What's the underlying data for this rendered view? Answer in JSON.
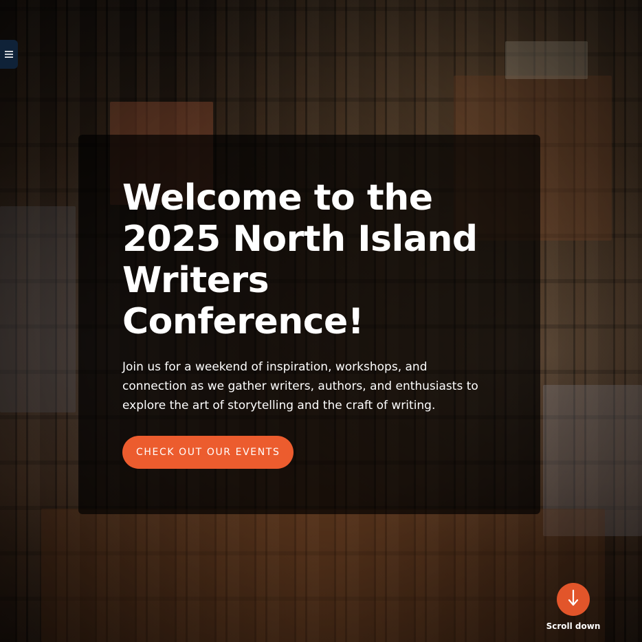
{
  "menu": {
    "icon": "hamburger-menu-icon"
  },
  "hero": {
    "title": "Welcome to the 2025 North Island Writers Conference!",
    "description": "Join us for a weekend of inspiration, workshops, and connection as we gather writers, authors, and enthusiasts to explore the art of storytelling and the craft of writing.",
    "cta_label": "CHECK OUT OUR EVENTS"
  },
  "scroll": {
    "icon": "arrow-down-icon",
    "label": "Scroll down"
  },
  "colors": {
    "accent": "#ec5c2e",
    "menu_bg": "#0f2238",
    "card_bg": "rgba(0,0,0,0.68)",
    "text": "#ffffff"
  }
}
